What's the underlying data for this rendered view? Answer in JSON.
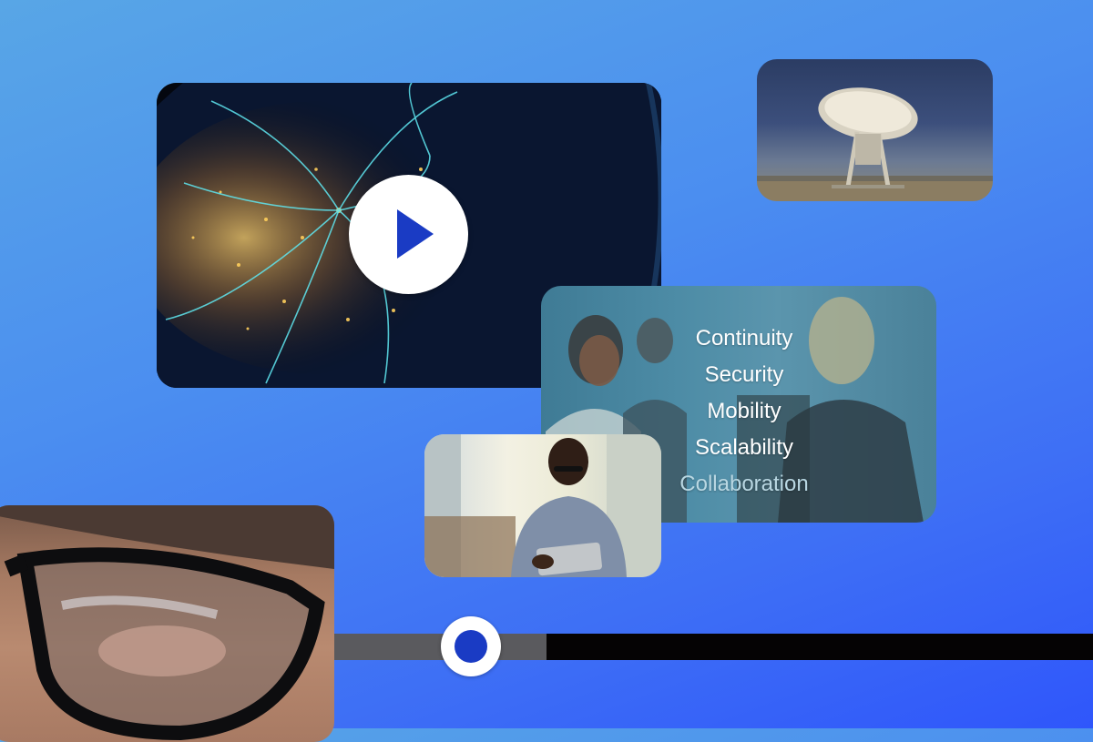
{
  "colors": {
    "accent": "#1a3bc4",
    "background_start": "#58a6e6",
    "background_end": "#2f56fb"
  },
  "player": {
    "play_icon": "play-icon",
    "progress_fraction": 0.28
  },
  "thumbnails": {
    "globe": "earth-at-night-network",
    "dish": "radio-telescope-dish",
    "meeting": "office-meeting",
    "tablet": "man-with-tablet",
    "glasses": "eye-with-glasses"
  },
  "meeting_words": [
    "Continuity",
    "Security",
    "Mobility",
    "Scalability",
    "Collaboration"
  ]
}
